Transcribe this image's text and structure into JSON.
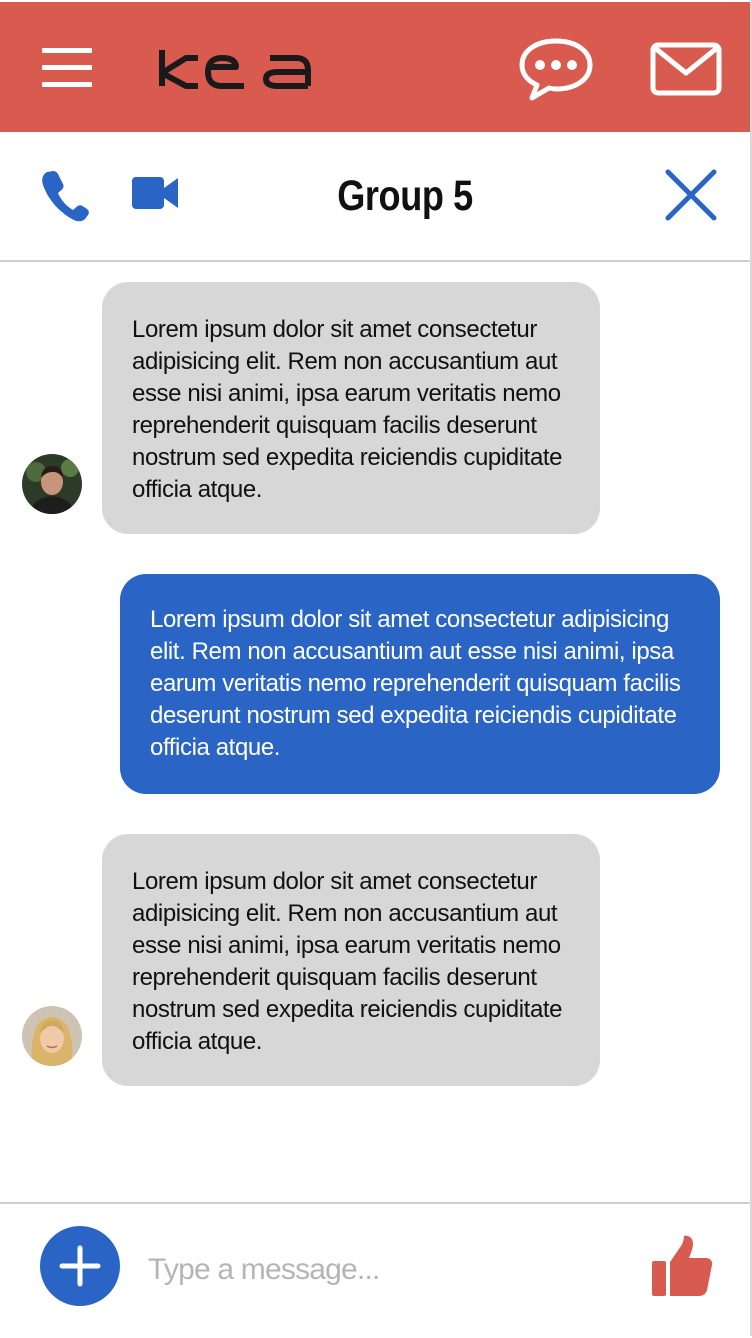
{
  "header": {
    "brand_text": "kea",
    "brand_color": "#d95b4f"
  },
  "chat_header": {
    "title": "Group 5",
    "accent_color": "#2a64c5"
  },
  "messages": [
    {
      "direction": "incoming",
      "avatar": "avatar-young-man",
      "text": "Lorem ipsum dolor sit amet consectetur adipisicing elit. Rem non accusantium aut esse nisi animi, ipsa earum veritatis nemo reprehenderit quisquam facilis deserunt nostrum sed expedita reiciendis cupiditate officia atque."
    },
    {
      "direction": "outgoing",
      "text": "Lorem ipsum dolor sit amet consectetur adipisicing elit. Rem non accusantium aut esse nisi animi, ipsa earum veritatis nemo reprehenderit quisquam facilis deserunt nostrum sed expedita reiciendis cupiditate officia atque."
    },
    {
      "direction": "incoming",
      "avatar": "avatar-blonde-woman",
      "text": "Lorem ipsum dolor sit amet consectetur adipisicing elit. Rem non accusantium aut esse nisi animi, ipsa earum veritatis nemo reprehenderit quisquam facilis deserunt nostrum sed expedita reiciendis cupiditate officia atque."
    }
  ],
  "composer": {
    "placeholder": "Type a message...",
    "value": ""
  },
  "icons": {
    "menu": "hamburger-menu-icon",
    "chat": "chat-bubble-icon",
    "mail": "envelope-icon",
    "call": "phone-icon",
    "video": "video-camera-icon",
    "close": "close-icon",
    "add": "plus-icon",
    "like": "thumbs-up-icon"
  }
}
